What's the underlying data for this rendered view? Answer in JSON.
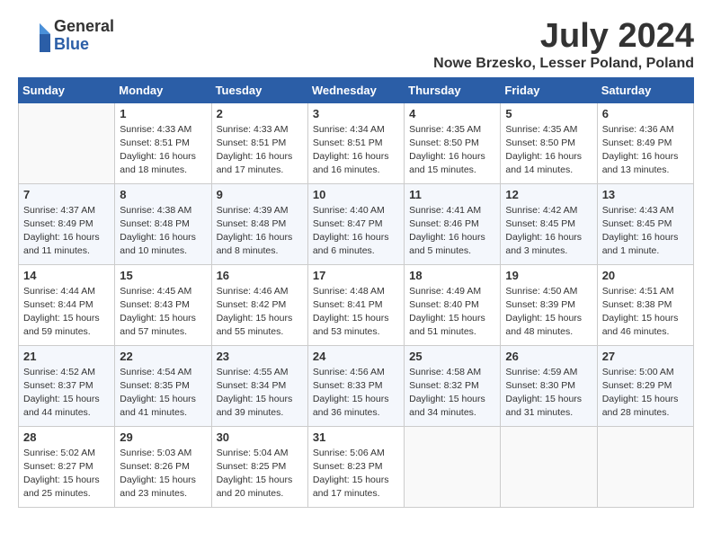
{
  "header": {
    "logo_general": "General",
    "logo_blue": "Blue",
    "month_title": "July 2024",
    "location": "Nowe Brzesko, Lesser Poland, Poland"
  },
  "days_of_week": [
    "Sunday",
    "Monday",
    "Tuesday",
    "Wednesday",
    "Thursday",
    "Friday",
    "Saturday"
  ],
  "weeks": [
    [
      {
        "day": "",
        "sunrise": "",
        "sunset": "",
        "daylight": ""
      },
      {
        "day": "1",
        "sunrise": "4:33 AM",
        "sunset": "8:51 PM",
        "daylight": "16 hours and 18 minutes."
      },
      {
        "day": "2",
        "sunrise": "4:33 AM",
        "sunset": "8:51 PM",
        "daylight": "16 hours and 17 minutes."
      },
      {
        "day": "3",
        "sunrise": "4:34 AM",
        "sunset": "8:51 PM",
        "daylight": "16 hours and 16 minutes."
      },
      {
        "day": "4",
        "sunrise": "4:35 AM",
        "sunset": "8:50 PM",
        "daylight": "16 hours and 15 minutes."
      },
      {
        "day": "5",
        "sunrise": "4:35 AM",
        "sunset": "8:50 PM",
        "daylight": "16 hours and 14 minutes."
      },
      {
        "day": "6",
        "sunrise": "4:36 AM",
        "sunset": "8:49 PM",
        "daylight": "16 hours and 13 minutes."
      }
    ],
    [
      {
        "day": "7",
        "sunrise": "4:37 AM",
        "sunset": "8:49 PM",
        "daylight": "16 hours and 11 minutes."
      },
      {
        "day": "8",
        "sunrise": "4:38 AM",
        "sunset": "8:48 PM",
        "daylight": "16 hours and 10 minutes."
      },
      {
        "day": "9",
        "sunrise": "4:39 AM",
        "sunset": "8:48 PM",
        "daylight": "16 hours and 8 minutes."
      },
      {
        "day": "10",
        "sunrise": "4:40 AM",
        "sunset": "8:47 PM",
        "daylight": "16 hours and 6 minutes."
      },
      {
        "day": "11",
        "sunrise": "4:41 AM",
        "sunset": "8:46 PM",
        "daylight": "16 hours and 5 minutes."
      },
      {
        "day": "12",
        "sunrise": "4:42 AM",
        "sunset": "8:45 PM",
        "daylight": "16 hours and 3 minutes."
      },
      {
        "day": "13",
        "sunrise": "4:43 AM",
        "sunset": "8:45 PM",
        "daylight": "16 hours and 1 minute."
      }
    ],
    [
      {
        "day": "14",
        "sunrise": "4:44 AM",
        "sunset": "8:44 PM",
        "daylight": "15 hours and 59 minutes."
      },
      {
        "day": "15",
        "sunrise": "4:45 AM",
        "sunset": "8:43 PM",
        "daylight": "15 hours and 57 minutes."
      },
      {
        "day": "16",
        "sunrise": "4:46 AM",
        "sunset": "8:42 PM",
        "daylight": "15 hours and 55 minutes."
      },
      {
        "day": "17",
        "sunrise": "4:48 AM",
        "sunset": "8:41 PM",
        "daylight": "15 hours and 53 minutes."
      },
      {
        "day": "18",
        "sunrise": "4:49 AM",
        "sunset": "8:40 PM",
        "daylight": "15 hours and 51 minutes."
      },
      {
        "day": "19",
        "sunrise": "4:50 AM",
        "sunset": "8:39 PM",
        "daylight": "15 hours and 48 minutes."
      },
      {
        "day": "20",
        "sunrise": "4:51 AM",
        "sunset": "8:38 PM",
        "daylight": "15 hours and 46 minutes."
      }
    ],
    [
      {
        "day": "21",
        "sunrise": "4:52 AM",
        "sunset": "8:37 PM",
        "daylight": "15 hours and 44 minutes."
      },
      {
        "day": "22",
        "sunrise": "4:54 AM",
        "sunset": "8:35 PM",
        "daylight": "15 hours and 41 minutes."
      },
      {
        "day": "23",
        "sunrise": "4:55 AM",
        "sunset": "8:34 PM",
        "daylight": "15 hours and 39 minutes."
      },
      {
        "day": "24",
        "sunrise": "4:56 AM",
        "sunset": "8:33 PM",
        "daylight": "15 hours and 36 minutes."
      },
      {
        "day": "25",
        "sunrise": "4:58 AM",
        "sunset": "8:32 PM",
        "daylight": "15 hours and 34 minutes."
      },
      {
        "day": "26",
        "sunrise": "4:59 AM",
        "sunset": "8:30 PM",
        "daylight": "15 hours and 31 minutes."
      },
      {
        "day": "27",
        "sunrise": "5:00 AM",
        "sunset": "8:29 PM",
        "daylight": "15 hours and 28 minutes."
      }
    ],
    [
      {
        "day": "28",
        "sunrise": "5:02 AM",
        "sunset": "8:27 PM",
        "daylight": "15 hours and 25 minutes."
      },
      {
        "day": "29",
        "sunrise": "5:03 AM",
        "sunset": "8:26 PM",
        "daylight": "15 hours and 23 minutes."
      },
      {
        "day": "30",
        "sunrise": "5:04 AM",
        "sunset": "8:25 PM",
        "daylight": "15 hours and 20 minutes."
      },
      {
        "day": "31",
        "sunrise": "5:06 AM",
        "sunset": "8:23 PM",
        "daylight": "15 hours and 17 minutes."
      },
      {
        "day": "",
        "sunrise": "",
        "sunset": "",
        "daylight": ""
      },
      {
        "day": "",
        "sunrise": "",
        "sunset": "",
        "daylight": ""
      },
      {
        "day": "",
        "sunrise": "",
        "sunset": "",
        "daylight": ""
      }
    ]
  ]
}
